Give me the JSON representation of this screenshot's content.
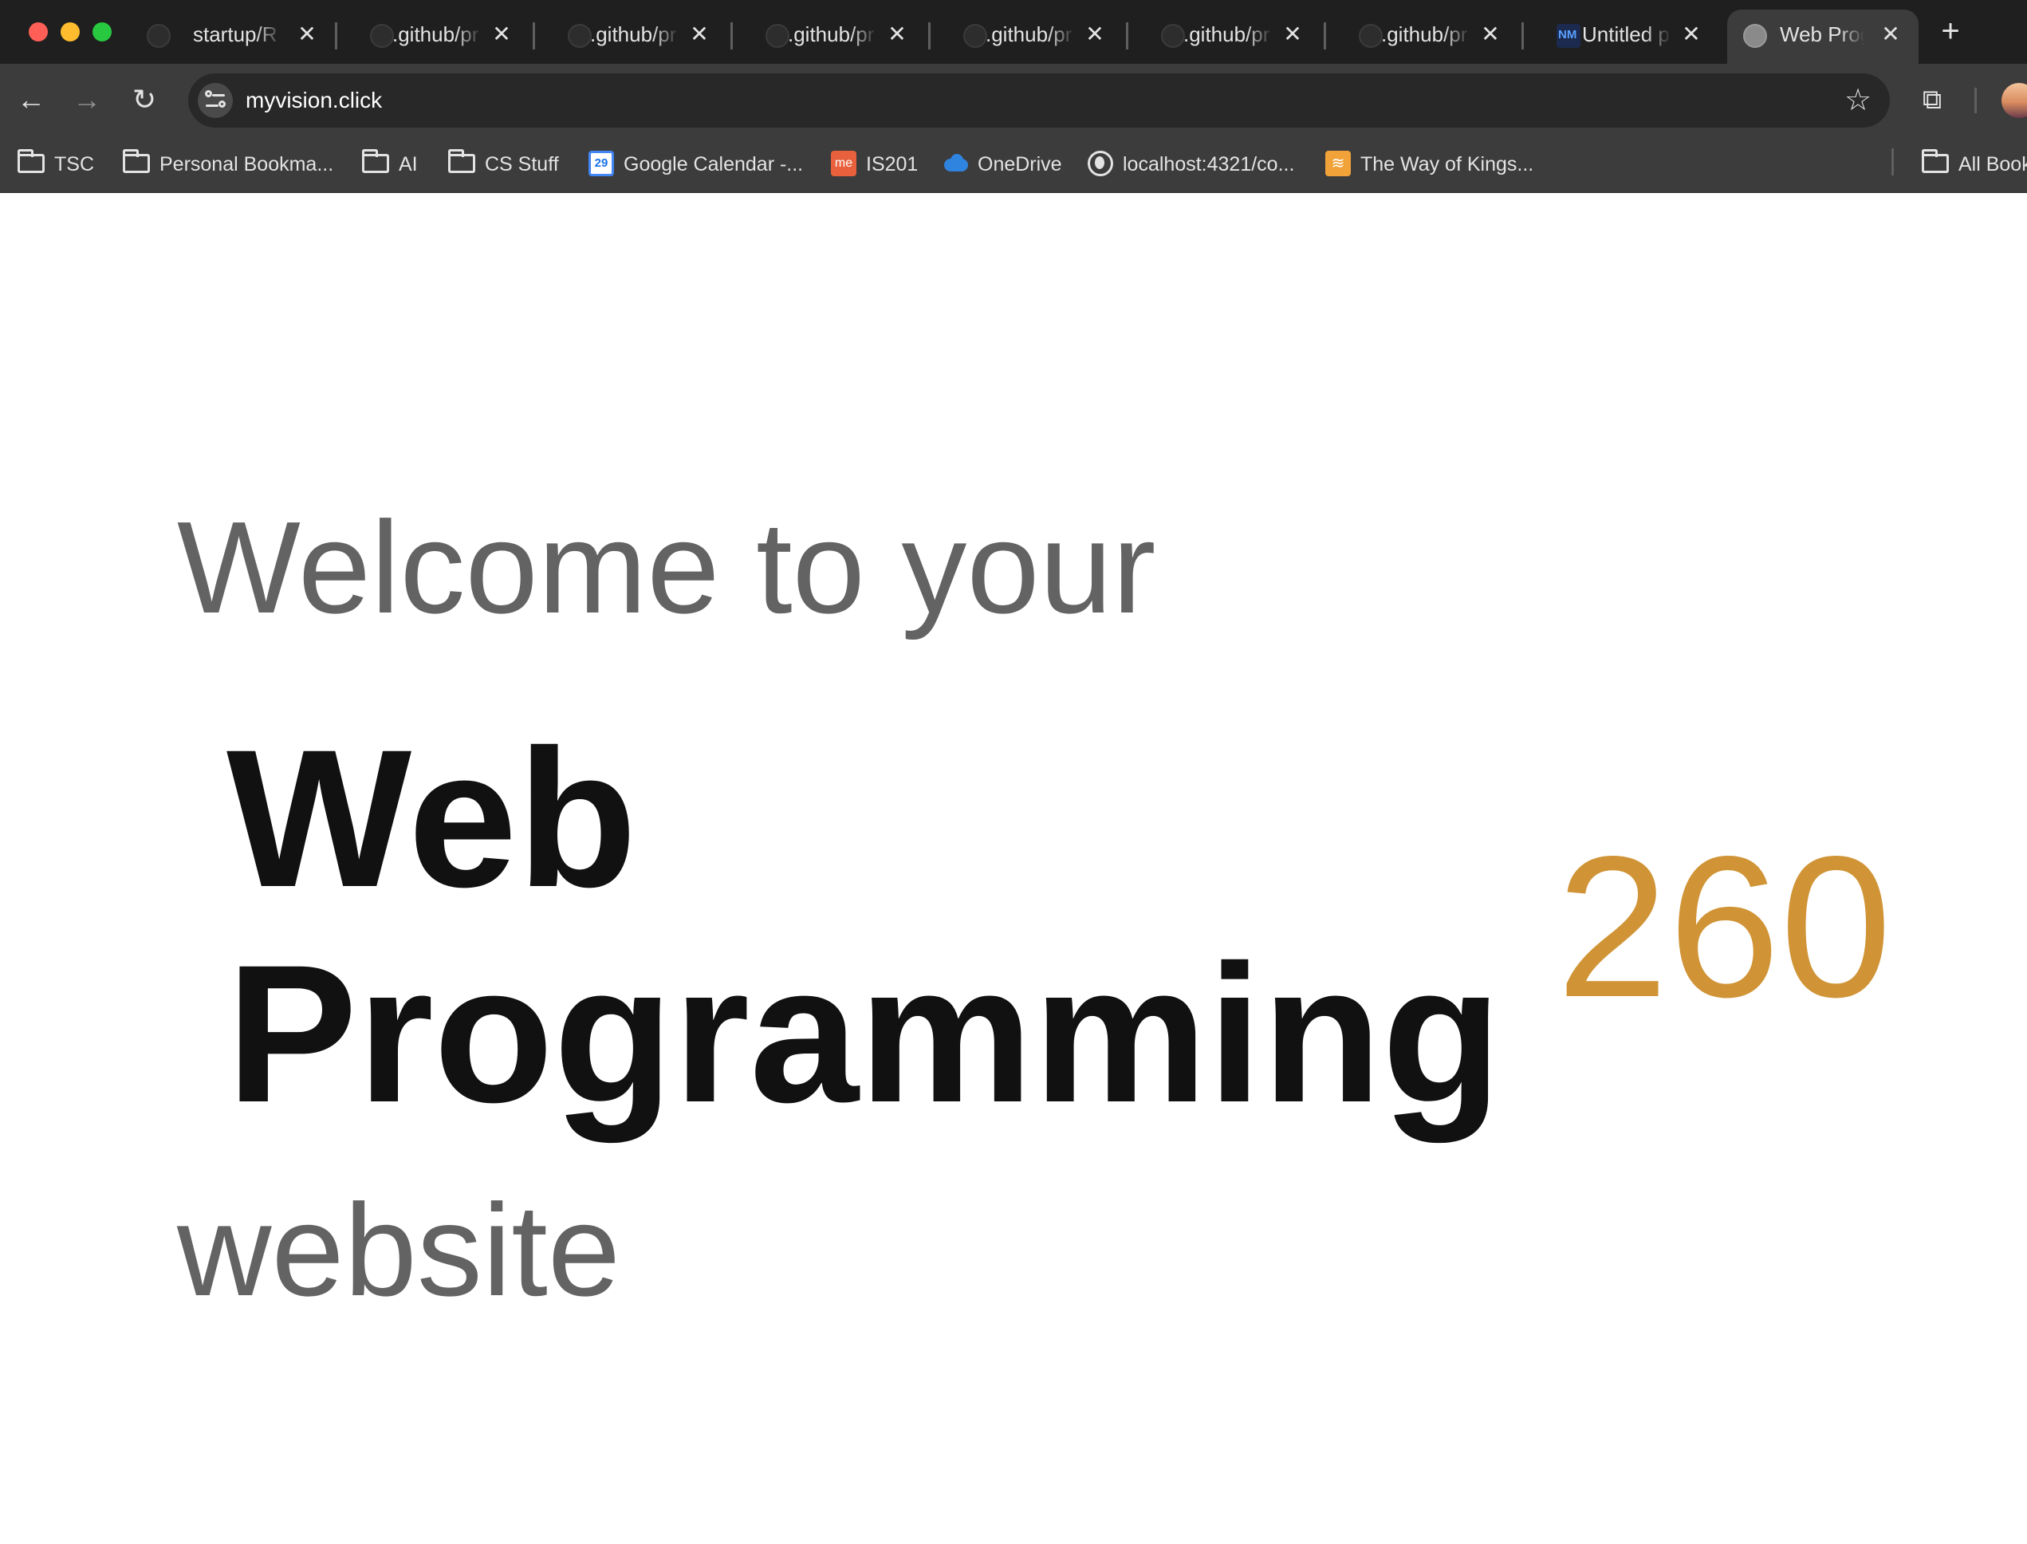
{
  "tabs": [
    {
      "title": "startup/R",
      "icon": "github-icon",
      "active": false
    },
    {
      "title": ".github/pr",
      "icon": "github-icon",
      "active": false
    },
    {
      "title": ".github/pr",
      "icon": "github-icon",
      "active": false
    },
    {
      "title": ".github/pr",
      "icon": "github-icon",
      "active": false
    },
    {
      "title": ".github/pr",
      "icon": "github-icon",
      "active": false
    },
    {
      "title": ".github/pr",
      "icon": "github-icon",
      "active": false
    },
    {
      "title": ".github/pr",
      "icon": "github-icon",
      "active": false
    },
    {
      "title": "Untitled p",
      "icon": "nm-icon",
      "active": false
    },
    {
      "title": "Web Prog",
      "icon": "globe-icon",
      "active": true
    }
  ],
  "toolbar": {
    "url": "myvision.click"
  },
  "bookmarks": {
    "items": [
      {
        "label": "TSC",
        "icon": "folder-icon"
      },
      {
        "label": "Personal Bookma...",
        "icon": "folder-icon"
      },
      {
        "label": "AI",
        "icon": "folder-icon"
      },
      {
        "label": "CS Stuff",
        "icon": "folder-icon"
      },
      {
        "label": "Google Calendar -...",
        "icon": "google-calendar-icon"
      },
      {
        "label": "IS201",
        "icon": "me-icon"
      },
      {
        "label": "OneDrive",
        "icon": "onedrive-icon"
      },
      {
        "label": "localhost:4321/co...",
        "icon": "globe-icon"
      },
      {
        "label": "The Way of Kings...",
        "icon": "audible-icon"
      }
    ],
    "all_bookmarks": "All Bookmarks"
  },
  "page": {
    "welcome": "Welcome to your",
    "title_line1": "Web",
    "title_line2": "Programming",
    "course_number": "260",
    "website": "website"
  },
  "colors": {
    "accent_number": "#d09437",
    "muted_text": "#636363",
    "title_text": "#111111"
  }
}
